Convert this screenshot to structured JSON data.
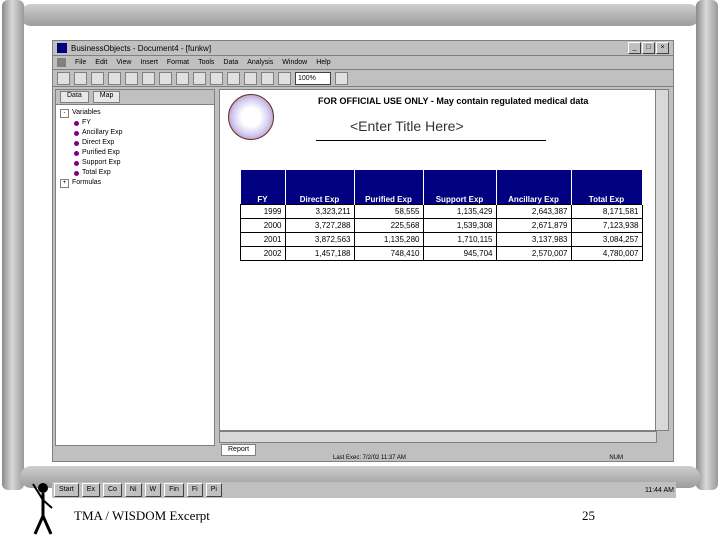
{
  "window": {
    "title": "BusinessObjects - Document4 - [funkw]",
    "controls": [
      "_",
      "□",
      "×"
    ]
  },
  "menu": [
    "File",
    "Edit",
    "View",
    "Insert",
    "Format",
    "Tools",
    "Data",
    "Analysis",
    "Window",
    "Help"
  ],
  "toolbar": {
    "zoom": "100%"
  },
  "left_pane": {
    "tabs": [
      "Data",
      "Map"
    ],
    "tree_root": "Variables",
    "tree_items": [
      "FY",
      "Ancillary Exp",
      "Direct Exp",
      "Purified Exp",
      "Support Exp",
      "Total Exp"
    ],
    "tree_formulas": "Formulas"
  },
  "report": {
    "banner": "FOR OFFICIAL USE ONLY - May contain regulated medical data",
    "title": "<Enter Title Here>",
    "columns": [
      "FY",
      "Direct Exp",
      "Purified Exp",
      "Support Exp",
      "Ancillary Exp",
      "Total Exp"
    ],
    "rows": [
      [
        "1999",
        "3,323,211",
        "58,555",
        "1,135,429",
        "2,643,387",
        "8,171,581"
      ],
      [
        "2000",
        "3,727,288",
        "225,568",
        "1,539,308",
        "2,671,879",
        "7,123,938"
      ],
      [
        "2001",
        "3,872,563",
        "1,135,280",
        "1,710,115",
        "3,137,983",
        "3,084,257"
      ],
      [
        "2002",
        "1,457,188",
        "748,410",
        "945,704",
        "2,570,007",
        "4,780,007"
      ]
    ],
    "tab_label": "Report"
  },
  "status": {
    "last_exec": "Last Exec: 7/2/02 11:37 AM",
    "mode": "NUM"
  },
  "taskbar": {
    "start": "Start",
    "items": [
      "Ex",
      "Co",
      "Ni",
      "W",
      "Fin",
      "Fi",
      "Pi"
    ],
    "clock": "11:44 AM"
  },
  "footer": {
    "left": "TMA / WISDOM Excerpt",
    "page": "25"
  }
}
